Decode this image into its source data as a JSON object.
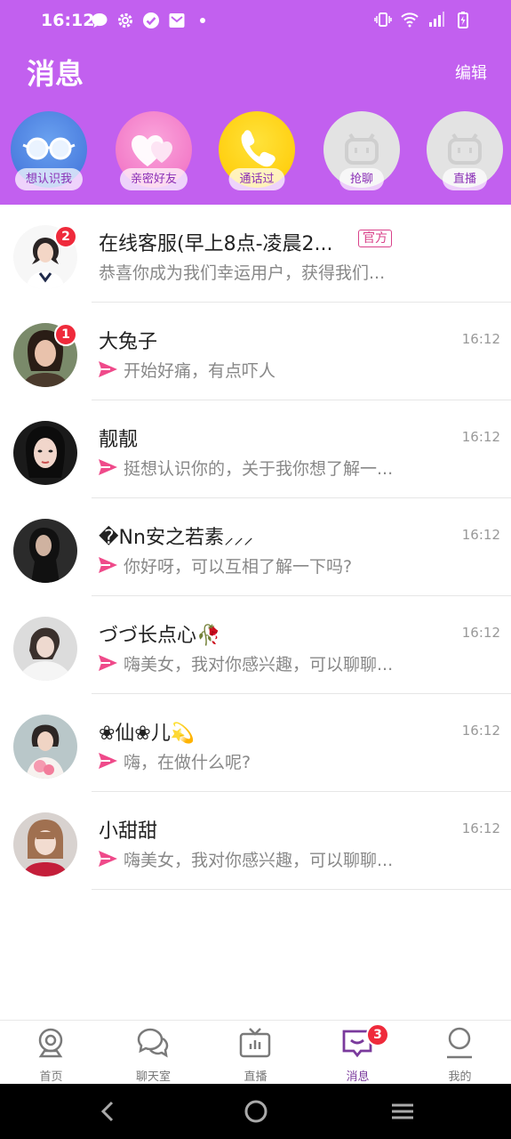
{
  "status_bar": {
    "time": "16:12",
    "left_icons": [
      "chat-bubble-icon",
      "gear-icon",
      "check-circle-icon",
      "mail-icon",
      "dot-icon"
    ],
    "right_icons": [
      "vibrate-icon",
      "wifi-icon",
      "signal-icon",
      "battery-charging-icon"
    ]
  },
  "header": {
    "title": "消息",
    "edit_label": "编辑",
    "background": "#c260ef"
  },
  "quick_entries": [
    {
      "label": "想认识我",
      "icon": "glasses-icon",
      "color": "#4a86e8"
    },
    {
      "label": "亲密好友",
      "icon": "hearts-icon",
      "color": "#f07ac4"
    },
    {
      "label": "通话过",
      "icon": "phone-icon",
      "color": "#ffd000"
    },
    {
      "label": "抢聊",
      "icon": "robot-icon",
      "color": "#e3e3e3"
    },
    {
      "label": "直播",
      "icon": "robot-icon",
      "color": "#e3e3e3"
    }
  ],
  "messages": [
    {
      "name": "在线客服(早上8点-凌晨2...",
      "tag": "官方",
      "preview": "恭喜你成为我们幸运用户，获得我们...",
      "time": "",
      "badge": "2",
      "sent": false
    },
    {
      "name": "大兔子",
      "tag": "",
      "preview": "开始好痛，有点吓人",
      "time": "16:12",
      "badge": "1",
      "sent": true
    },
    {
      "name": "靓靓",
      "tag": "",
      "preview": "挺想认识你的，关于我你想了解一...",
      "time": "16:12",
      "badge": "",
      "sent": true
    },
    {
      "name": "�Nn安之若素⸝⸝⸝",
      "tag": "",
      "preview": "你好呀，可以互相了解一下吗?",
      "time": "16:12",
      "badge": "",
      "sent": true
    },
    {
      "name": "づづ长点心🥀",
      "tag": "",
      "preview": "嗨美女，我对你感兴趣，可以聊聊...",
      "time": "16:12",
      "badge": "",
      "sent": true
    },
    {
      "name": "❀仙❀儿💫",
      "tag": "",
      "preview": "嗨，在做什么呢?",
      "time": "16:12",
      "badge": "",
      "sent": true
    },
    {
      "name": "小甜甜",
      "tag": "",
      "preview": "嗨美女，我对你感兴趣，可以聊聊...",
      "time": "16:12",
      "badge": "",
      "sent": true
    }
  ],
  "bottom_nav": [
    {
      "label": "首页",
      "icon": "webcam-icon"
    },
    {
      "label": "聊天室",
      "icon": "chat-bubbles-icon"
    },
    {
      "label": "直播",
      "icon": "tv-icon"
    },
    {
      "label": "消息",
      "icon": "message-icon",
      "badge": "3",
      "active": true
    },
    {
      "label": "我的",
      "icon": "profile-icon"
    }
  ],
  "colors": {
    "accent": "#c260ef",
    "badge": "#ef2a3b",
    "send_arrow": "#ef4a8a",
    "active_tab": "#7a3a9c"
  }
}
